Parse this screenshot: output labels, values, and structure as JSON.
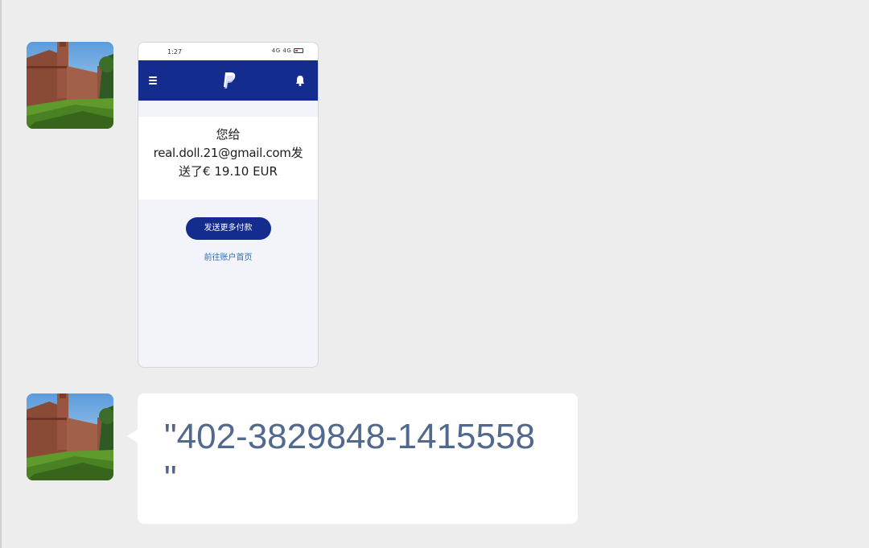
{
  "messages": [
    {
      "type": "image",
      "screenshot": {
        "status_time": "1:27",
        "status_icons": "4G 4G",
        "app": "PayPal",
        "line1": "您给",
        "line2": "real.doll.21@gmail.com发",
        "line3": "送了€ 19.10 EUR",
        "button_label": "发送更多付款",
        "link_label": "前往账户首页",
        "nav_color": "#142c8e"
      }
    },
    {
      "type": "text",
      "quote_open": "\"",
      "number": "402-3829848-1415558",
      "quote_close": "\""
    }
  ],
  "colors": {
    "background": "#ededed",
    "bubble": "#ffffff",
    "text": "#556580"
  }
}
